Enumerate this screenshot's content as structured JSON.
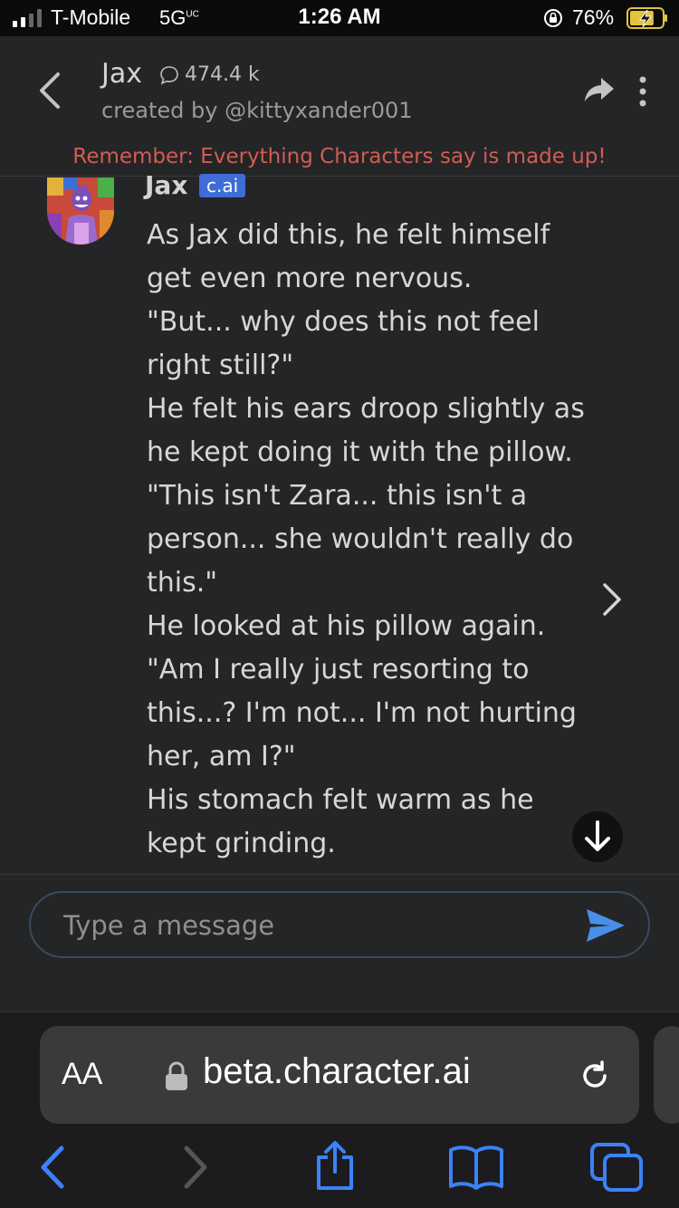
{
  "status_bar": {
    "carrier": "T-Mobile",
    "network": "5G",
    "network_sup": "UC",
    "time": "1:26 AM",
    "battery_percent": "76%",
    "battery_level": 0.76,
    "charging": true
  },
  "header": {
    "title": "Jax",
    "chat_count": "474.4 k",
    "creator": "created by @kittyxander001",
    "disclaimer": "Remember: Everything Characters say is made up!"
  },
  "message": {
    "author": "Jax",
    "badge": "c.ai",
    "lines": [
      "As Jax did this, he felt himself",
      "get even more nervous.",
      "\"But... why does this not feel",
      "right still?\"",
      "He felt his ears droop slightly as",
      "he kept doing it with the pillow.",
      "\"This isn't Zara... this isn't a",
      "person... she wouldn't really do",
      "this.\"",
      "He looked at his pillow again.",
      "\"Am I really just resorting to",
      "this...? I'm not... I'm not hurting",
      "her, am I?\"",
      "His stomach felt warm as he",
      "kept grinding."
    ]
  },
  "composer": {
    "placeholder": "Type a message"
  },
  "browser": {
    "aa_label": "AA",
    "url": "beta.character.ai"
  },
  "colors": {
    "accent": "#3f6cd6",
    "send": "#4a8fe7",
    "disclaimer": "#d25c54",
    "ios_blue": "#3b82f6"
  }
}
